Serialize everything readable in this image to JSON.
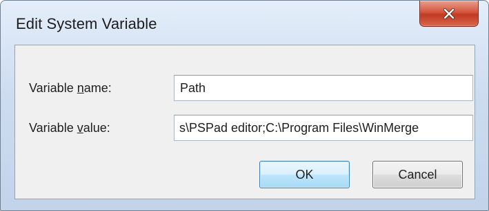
{
  "window": {
    "title": "Edit System Variable",
    "close_icon": "close-icon"
  },
  "form": {
    "variable_name": {
      "label_prefix": "Variable ",
      "label_accel": "n",
      "label_suffix": "ame:",
      "value": "Path"
    },
    "variable_value": {
      "label_prefix": "Variable ",
      "label_accel": "v",
      "label_suffix": "alue:",
      "value": "s\\PSPad editor;C:\\Program Files\\WinMerge"
    }
  },
  "buttons": {
    "ok_label": "OK",
    "cancel_label": "Cancel"
  },
  "colors": {
    "close_button": "#c9442b",
    "ok_border": "#3c7fb1",
    "title_bar": "#cddcf0"
  }
}
